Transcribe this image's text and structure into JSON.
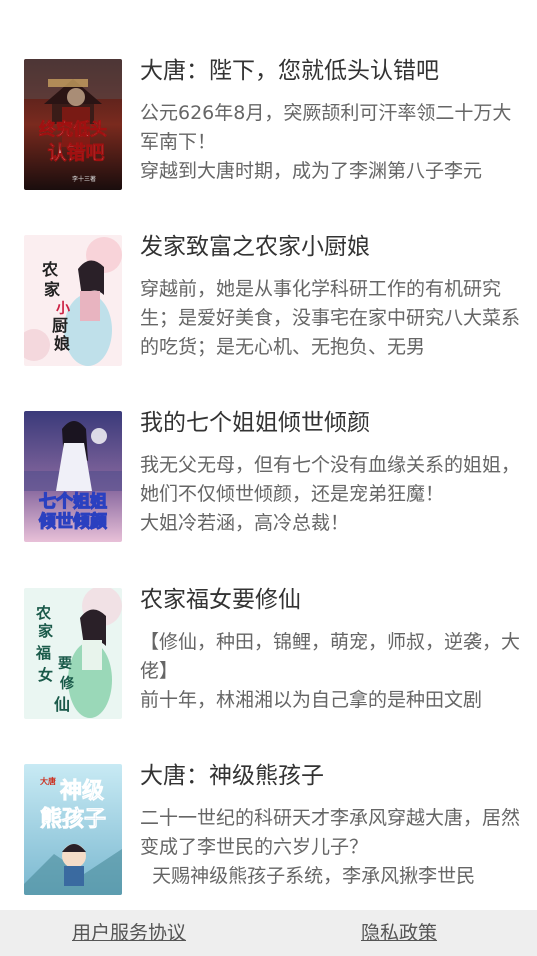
{
  "books": [
    {
      "title": "大唐：陛下，您就低头认错吧",
      "desc_lines": [
        "公元626年8月，突厥颉利可汗率领二十万大军南下！",
        "穿越到大唐时期，成为了李渊第八子李元"
      ],
      "cover": {
        "text": "终究低头认错吧",
        "author": "李十三著"
      }
    },
    {
      "title": "发家致富之农家小厨娘",
      "desc_lines": [
        "穿越前，她是从事化学科研工作的有机研究生；是爱好美食，没事宅在家中研究八大菜系的吃货；是无心机、无抱负、无男"
      ],
      "cover": {
        "text": "农家小厨娘",
        "author": ""
      }
    },
    {
      "title": "我的七个姐姐倾世倾颜",
      "desc_lines": [
        "我无父无母，但有七个没有血缘关系的姐姐，她们不仅倾世倾颜，还是宠弟狂魔！",
        "大姐冷若涵，高冷总裁！"
      ],
      "cover": {
        "text": "七个姐姐倾世倾颜",
        "author": ""
      }
    },
    {
      "title": "农家福女要修仙",
      "desc_lines": [
        "【修仙，种田，锦鲤，萌宠，师叔，逆袭，大佬】",
        "前十年，林湘湘以为自己拿的是种田文剧"
      ],
      "cover": {
        "text": "农家福女要修仙",
        "author": ""
      }
    },
    {
      "title": "大唐：神级熊孩子",
      "desc_lines": [
        "二十一世纪的科研天才李承风穿越大唐，居然变成了李世民的六岁儿子？",
        "  天赐神级熊孩子系统，李承风揪李世民"
      ],
      "cover": {
        "text": "神级熊孩子",
        "author": ""
      }
    }
  ],
  "footer": {
    "terms_label": "用户服务协议",
    "privacy_label": "隐私政策"
  }
}
